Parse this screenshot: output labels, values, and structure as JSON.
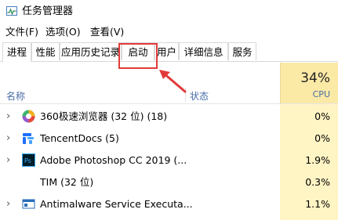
{
  "window": {
    "title": "任务管理器",
    "icon": "task-manager-icon"
  },
  "menu": [
    {
      "label": "文件(F)"
    },
    {
      "label": "选项(O)"
    },
    {
      "label": "查看(V)"
    }
  ],
  "tabs": [
    {
      "label": "进程",
      "active": true
    },
    {
      "label": "性能"
    },
    {
      "label": "应用历史记录"
    },
    {
      "label": "启动",
      "highlighted": true
    },
    {
      "label": "用户"
    },
    {
      "label": "详细信息"
    },
    {
      "label": "服务"
    }
  ],
  "columns": {
    "name": "名称",
    "status": "状态",
    "cpu_percent": "34%",
    "cpu": "CPU"
  },
  "processes": [
    {
      "name": "360极速浏览器 (32 位) (18)",
      "cpu": "0%",
      "icon": "360-browser-icon",
      "expandable": true
    },
    {
      "name": "TencentDocs (5)",
      "cpu": "0%",
      "icon": "tencent-docs-icon",
      "expandable": true
    },
    {
      "name": "Adobe Photoshop CC 2019 (...",
      "cpu": "1.9%",
      "icon": "photoshop-icon",
      "expandable": true
    },
    {
      "name": "TIM (32 位)",
      "cpu": "0.3%",
      "icon": "",
      "expandable": false
    },
    {
      "name": "Antimalware Service Executa...",
      "cpu": "1.1%",
      "icon": "antimalware-service-icon",
      "expandable": true
    }
  ],
  "colors": {
    "highlight": "#e23a3a",
    "cpu_band": "#fff4c4",
    "cpu_header": "#fbe9a6",
    "header_text": "#4a6da7"
  }
}
